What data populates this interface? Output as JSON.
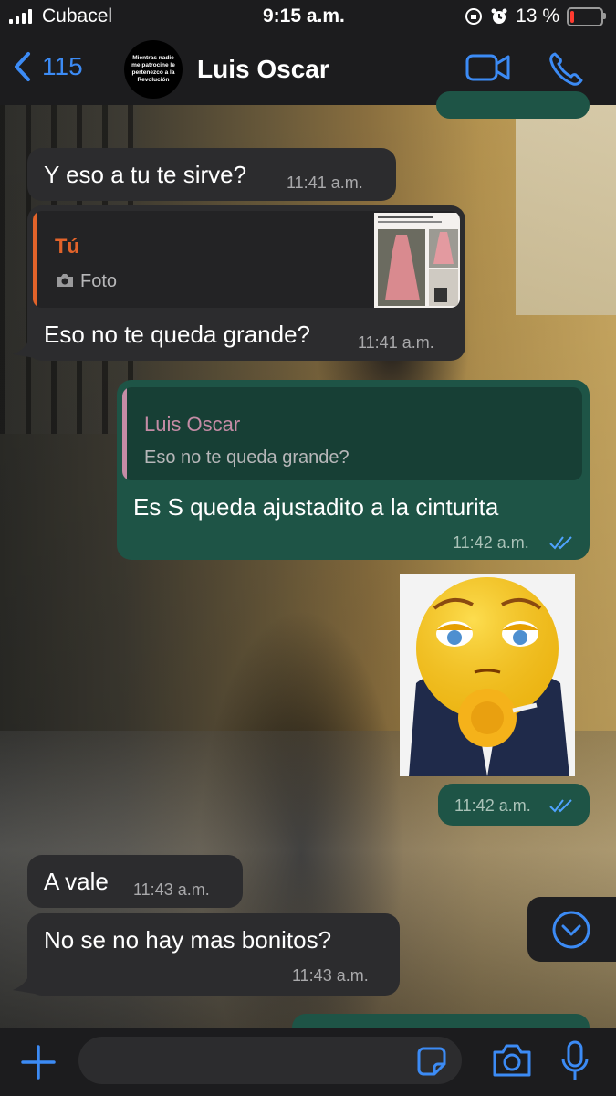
{
  "status_bar": {
    "carrier": "Cubacel",
    "time": "9:15 a.m.",
    "battery_percent_label": "13 %",
    "battery_level": 0.13
  },
  "header": {
    "back_count": "115",
    "contact_name": "Luis Oscar",
    "avatar_text": "Mientras nadie me patrocine le pertenezco a la Revolución"
  },
  "messages": [
    {
      "id": "m1",
      "direction": "in",
      "text": "Y eso a tu te sirve?",
      "time": "11:41 a.m."
    },
    {
      "id": "m2",
      "direction": "in",
      "quote_author": "Tú",
      "quote_text": "Foto",
      "text": "Eso no te queda grande?",
      "time": "11:41 a.m."
    },
    {
      "id": "m3",
      "direction": "out",
      "quote_author": "Luis Oscar",
      "quote_text": "Eso no te queda grande?",
      "text": "Es  S queda ajustadito a la cinturita",
      "time": "11:42 a.m."
    },
    {
      "id": "m4",
      "direction": "out",
      "type": "sticker",
      "time": "11:42 a.m."
    },
    {
      "id": "m5",
      "direction": "in",
      "text": "A vale",
      "time": "11:43 a.m."
    },
    {
      "id": "m6",
      "direction": "in",
      "text": "No se no hay mas bonitos?",
      "time": "11:43 a.m."
    }
  ],
  "colors": {
    "accent_blue": "#3c8bf5",
    "outgoing_bubble": "#1e5446",
    "incoming_bubble": "#2c2c2e",
    "quote_you": "#e2632a",
    "quote_contact": "#c58ca6",
    "read_ticks": "#4fa3ff",
    "battery_low": "#ff3b30"
  },
  "icons": {
    "back": "chevron-left-icon",
    "video": "video-camera-icon",
    "call": "phone-icon",
    "attach": "plus-icon",
    "sticker": "sticker-icon",
    "camera": "camera-icon",
    "mic": "microphone-icon",
    "scroll": "chevron-down-icon"
  }
}
